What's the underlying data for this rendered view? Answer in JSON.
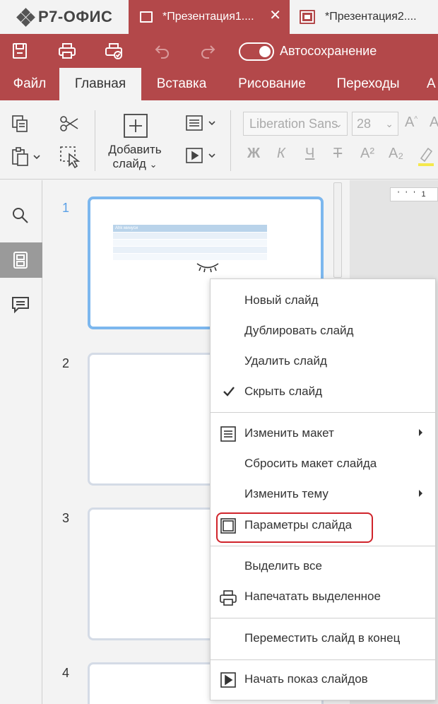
{
  "app": {
    "logo_text": "Р7-ОФИС"
  },
  "tabs": [
    {
      "label": "*Презентация1....",
      "active": true
    },
    {
      "label": "*Презентация2...."
    }
  ],
  "quick": {
    "autosave_label": "Автосохранение",
    "autosave_on": true
  },
  "menu": {
    "items": [
      "Файл",
      "Главная",
      "Вставка",
      "Рисование",
      "Переходы",
      "А"
    ],
    "active_index": 1
  },
  "toolbar": {
    "add_slide_line1": "Добавить",
    "add_slide_line2": "слайд",
    "font_name": "Liberation Sans",
    "font_size": "28",
    "format_buttons": [
      "Ж",
      "К",
      "Ч",
      "Т",
      "A²",
      "A₂"
    ]
  },
  "slides": {
    "numbers": [
      "1",
      "2",
      "3",
      "4"
    ],
    "selected": "1",
    "thumb1_table_header": "Ahk минуcи"
  },
  "ruler": {
    "text": "' ' ' 1"
  },
  "context_menu": {
    "items": [
      {
        "label": "Новый слайд"
      },
      {
        "label": "Дублировать слайд"
      },
      {
        "label": "Удалить слайд"
      },
      {
        "label": "Скрыть слайд",
        "checked": true
      },
      {
        "label": "Изменить макет",
        "icon": "layout-icon",
        "submenu": true
      },
      {
        "label": "Сбросить макет слайда"
      },
      {
        "label": "Изменить тему",
        "submenu": true
      },
      {
        "label": "Параметры слайда",
        "icon": "slide-settings-icon",
        "highlighted": true
      },
      {
        "label": "Выделить все"
      },
      {
        "label": "Напечатать выделенное",
        "icon": "print-icon"
      },
      {
        "label": "Переместить слайд в конец"
      },
      {
        "label": "Начать показ слайдов",
        "icon": "play-icon"
      }
    ]
  },
  "colors": {
    "brand": "#b3484a",
    "selection": "#7cb7ee",
    "highlight": "#d0242b"
  }
}
